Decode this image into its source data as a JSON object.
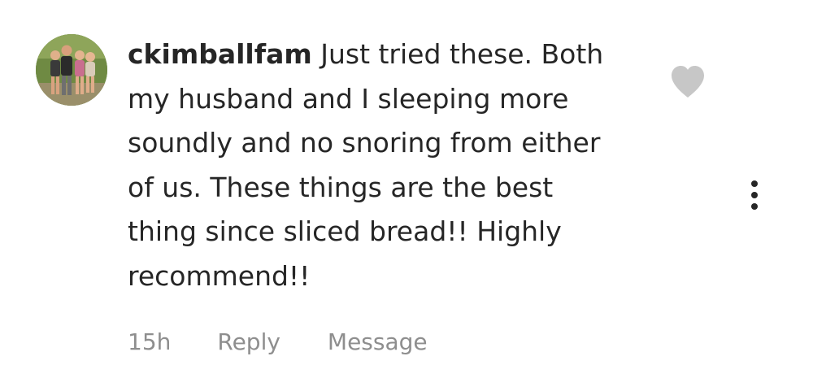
{
  "comment": {
    "username": "ckimballfam",
    "text": " Just tried these. Both\nmy husband and I sleeping more\nsoundly and no snoring from either\nof us.  These things are the best\nthing since sliced bread!! Highly\nrecommend!!",
    "time": "15h",
    "reply_label": "Reply",
    "message_label": "Message"
  },
  "icons": {
    "like": "heart-icon",
    "more": "more-options-icon"
  },
  "colors": {
    "text": "#262626",
    "secondary": "#8e8e8e",
    "heart": "#c7c7c7"
  }
}
